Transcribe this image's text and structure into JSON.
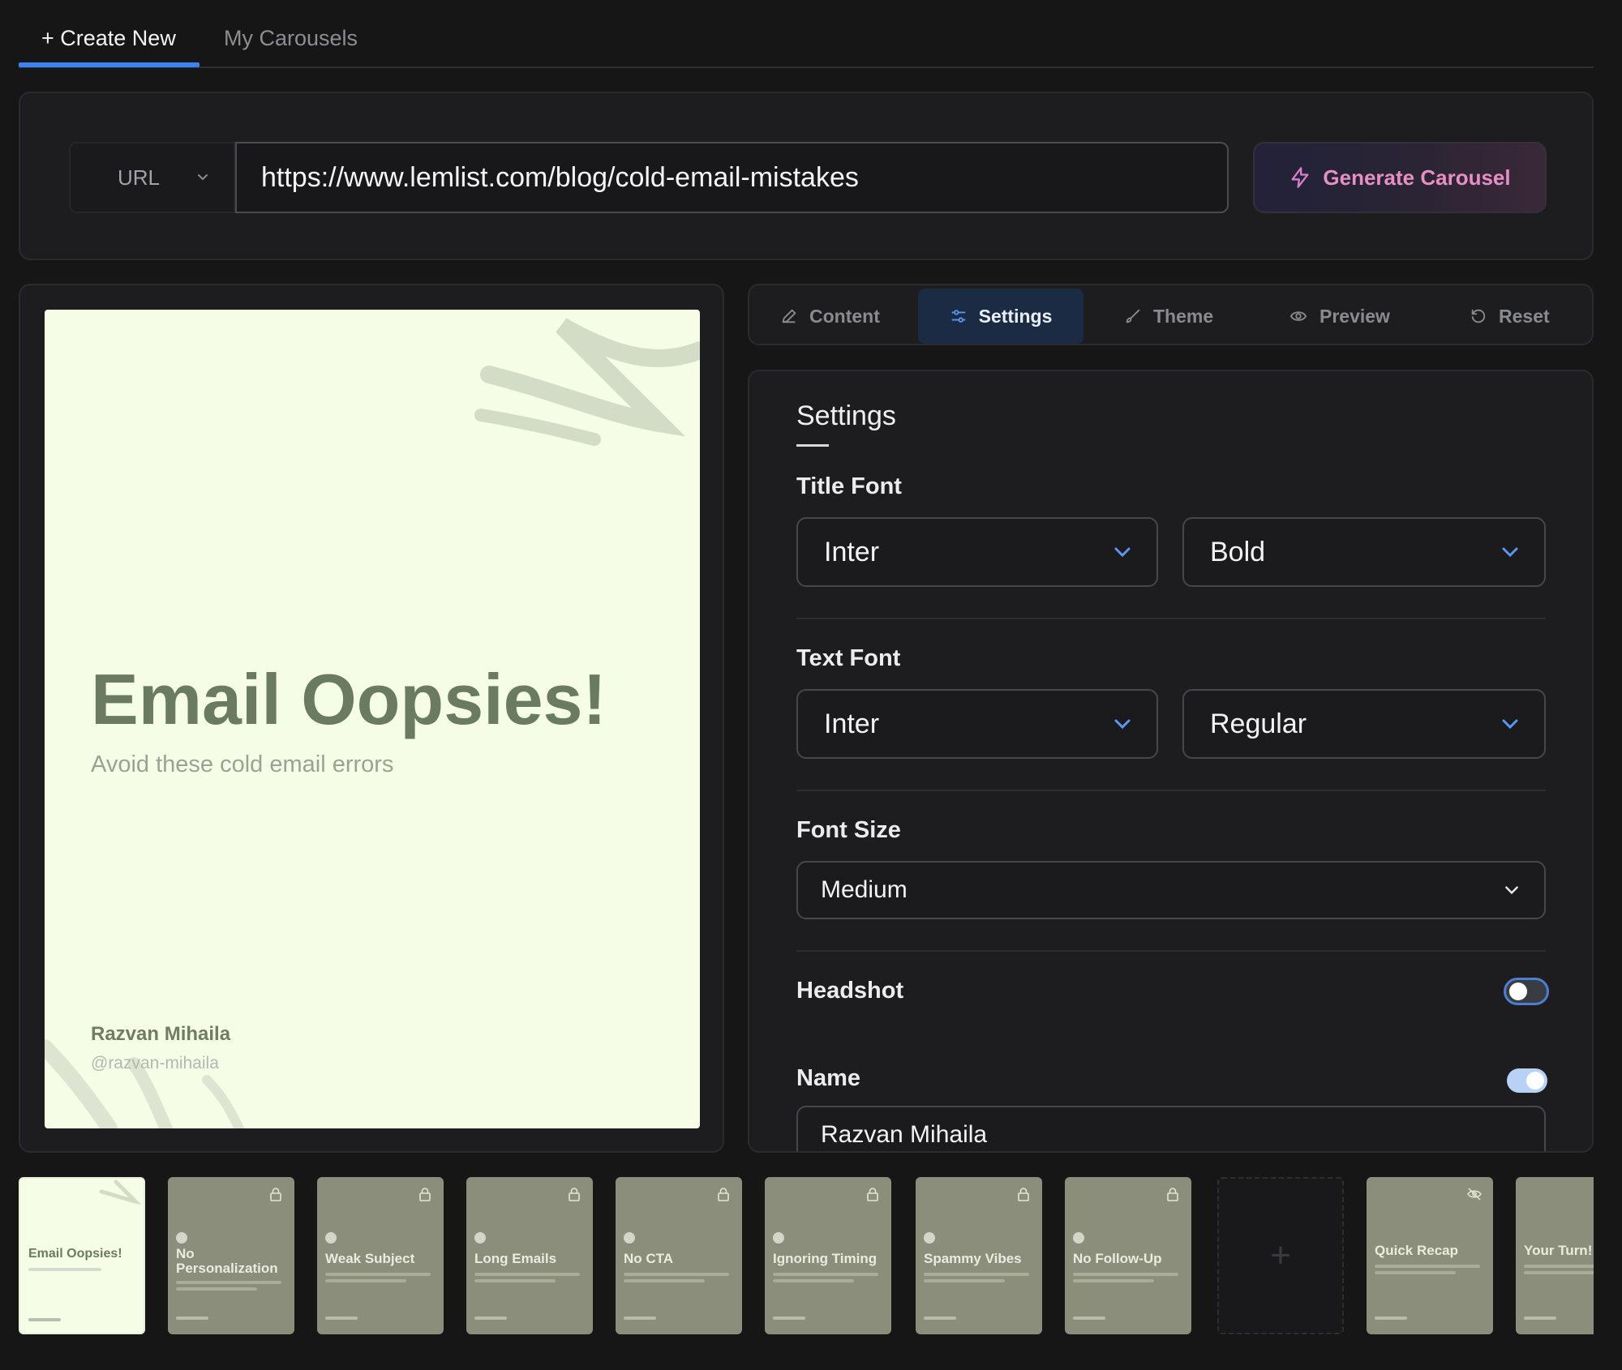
{
  "top_tabs": [
    {
      "label": "+ Create New",
      "active": true
    },
    {
      "label": "My Carousels",
      "active": false
    }
  ],
  "url_bar": {
    "source_type": "URL",
    "url_value": "https://www.lemlist.com/blog/cold-email-mistakes",
    "generate_label": "Generate Carousel"
  },
  "slide_preview": {
    "title": "Email Oopsies!",
    "subtitle": "Avoid these cold email errors",
    "author_name": "Razvan Mihaila",
    "author_handle": "@razvan-mihaila",
    "background_color": "#f6fde6",
    "accent_color": "#6a7b62"
  },
  "editor_tabs": [
    {
      "label": "Content",
      "icon": "pencil-icon",
      "active": false
    },
    {
      "label": "Settings",
      "icon": "sliders-icon",
      "active": true
    },
    {
      "label": "Theme",
      "icon": "brush-icon",
      "active": false
    },
    {
      "label": "Preview",
      "icon": "eye-icon",
      "active": false
    },
    {
      "label": "Reset",
      "icon": "reset-icon",
      "active": false
    }
  ],
  "settings": {
    "heading": "Settings",
    "title_font": {
      "label": "Title Font",
      "family": "Inter",
      "weight": "Bold"
    },
    "text_font": {
      "label": "Text Font",
      "family": "Inter",
      "weight": "Regular"
    },
    "font_size": {
      "label": "Font Size",
      "value": "Medium"
    },
    "headshot": {
      "label": "Headshot",
      "enabled": false
    },
    "name": {
      "label": "Name",
      "enabled": true,
      "value": "Razvan Mihaila"
    }
  },
  "thumbnails": [
    {
      "title": "Email Oopsies!",
      "active": true,
      "icon": "none"
    },
    {
      "title": "No Personalization",
      "active": false,
      "icon": "lock-icon"
    },
    {
      "title": "Weak Subject",
      "active": false,
      "icon": "lock-icon"
    },
    {
      "title": "Long Emails",
      "active": false,
      "icon": "lock-icon"
    },
    {
      "title": "No CTA",
      "active": false,
      "icon": "lock-icon"
    },
    {
      "title": "Ignoring Timing",
      "active": false,
      "icon": "lock-icon"
    },
    {
      "title": "Spammy Vibes",
      "active": false,
      "icon": "lock-icon"
    },
    {
      "title": "No Follow-Up",
      "active": false,
      "icon": "lock-icon"
    },
    {
      "title": "+",
      "active": false,
      "icon": "plus-icon",
      "add_slot": true
    },
    {
      "title": "Quick Recap",
      "active": false,
      "icon": "eye-off-icon"
    },
    {
      "title": "Your Turn!",
      "active": false,
      "icon": "none"
    }
  ],
  "colors": {
    "accent_blue": "#3a82f6",
    "generate_pink": "#e78fc4",
    "toggle_on": "#b8d2f5",
    "toggle_off": "#3a3c44"
  }
}
